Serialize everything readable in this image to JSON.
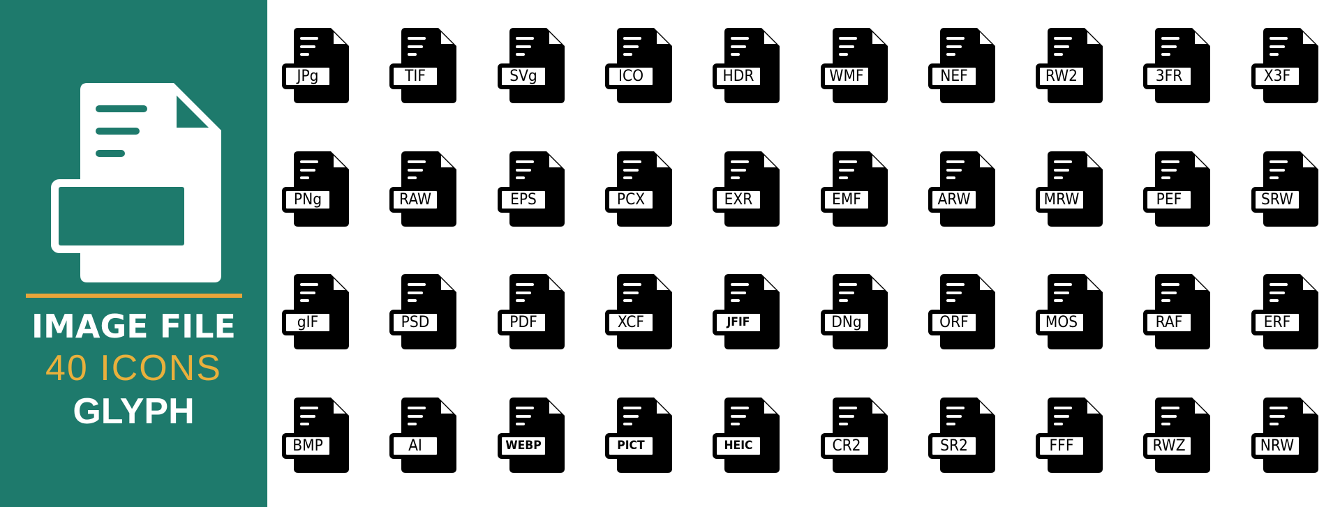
{
  "panel": {
    "background": "#1e7a6c",
    "accent_color": "#e8a53a",
    "hero_icon": "image-file-icon",
    "title_line_1": "IMAGE FILE",
    "title_line_2": "40 ICONS",
    "title_line_3": "GLYPH"
  },
  "icon_grid": {
    "rows": 4,
    "columns": 10,
    "icon_color": "#000000",
    "icons": [
      {
        "label": "JPG",
        "display": "JPg"
      },
      {
        "label": "TIF",
        "display": "TIF"
      },
      {
        "label": "SVG",
        "display": "SVg"
      },
      {
        "label": "ICO",
        "display": "ICO"
      },
      {
        "label": "HDR",
        "display": "HDR"
      },
      {
        "label": "WMF",
        "display": "WMF"
      },
      {
        "label": "NEF",
        "display": "NEF"
      },
      {
        "label": "RW2",
        "display": "RW2"
      },
      {
        "label": "3FR",
        "display": "3FR"
      },
      {
        "label": "X3F",
        "display": "X3F"
      },
      {
        "label": "PNG",
        "display": "PNg"
      },
      {
        "label": "RAW",
        "display": "RAW"
      },
      {
        "label": "EPS",
        "display": "EPS"
      },
      {
        "label": "PCX",
        "display": "PCX"
      },
      {
        "label": "EXR",
        "display": "EXR"
      },
      {
        "label": "EMF",
        "display": "EMF"
      },
      {
        "label": "ARW",
        "display": "ARW"
      },
      {
        "label": "MRW",
        "display": "MRW"
      },
      {
        "label": "PEF",
        "display": "PEF"
      },
      {
        "label": "SRW",
        "display": "SRW"
      },
      {
        "label": "GIF",
        "display": "gIF"
      },
      {
        "label": "PSD",
        "display": "PSD"
      },
      {
        "label": "PDF",
        "display": "PDF"
      },
      {
        "label": "XCF",
        "display": "XCF"
      },
      {
        "label": "JFIF",
        "display": "JFIF"
      },
      {
        "label": "DNG",
        "display": "DNg"
      },
      {
        "label": "ORF",
        "display": "ORF"
      },
      {
        "label": "MOS",
        "display": "MOS"
      },
      {
        "label": "RAF",
        "display": "RAF"
      },
      {
        "label": "ERF",
        "display": "ERF"
      },
      {
        "label": "BMP",
        "display": "BMP"
      },
      {
        "label": "AI",
        "display": "AI"
      },
      {
        "label": "WEBP",
        "display": "WEBP"
      },
      {
        "label": "PICT",
        "display": "PICT"
      },
      {
        "label": "HEIC",
        "display": "HEIC"
      },
      {
        "label": "CR2",
        "display": "CR2"
      },
      {
        "label": "SR2",
        "display": "SR2"
      },
      {
        "label": "FFF",
        "display": "FFF"
      },
      {
        "label": "RWZ",
        "display": "RWZ"
      },
      {
        "label": "NRW",
        "display": "NRW"
      }
    ]
  }
}
